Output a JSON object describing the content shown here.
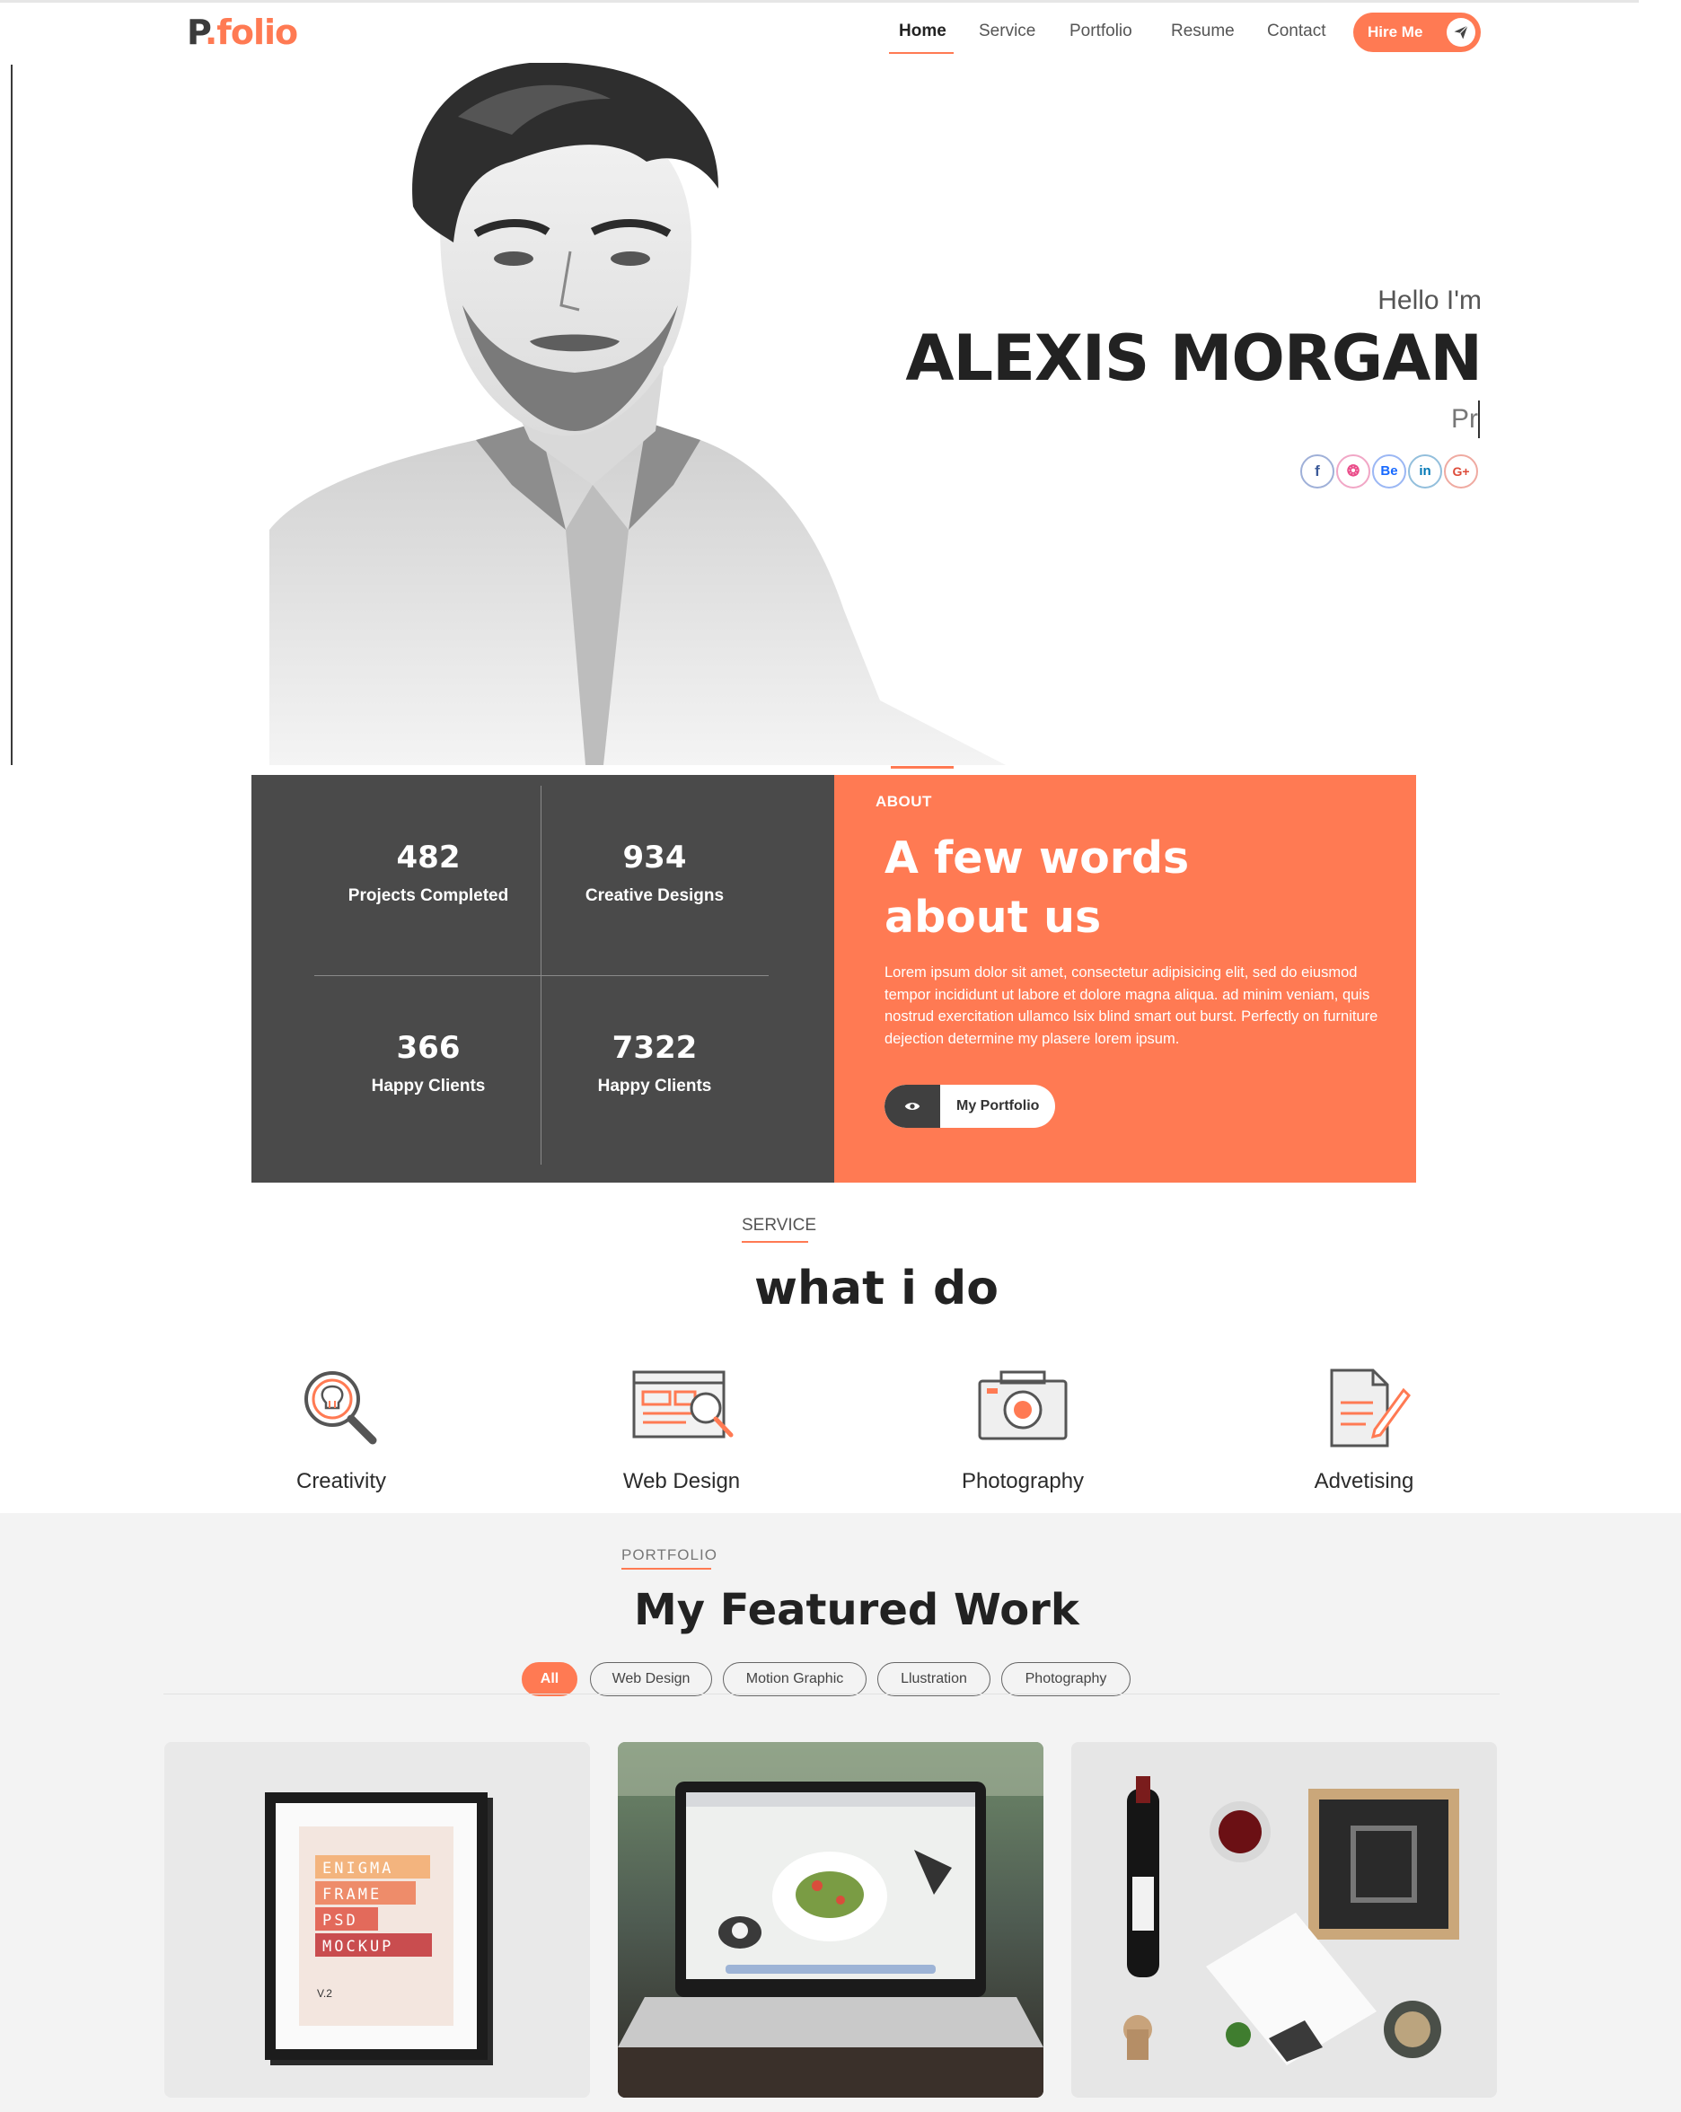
{
  "header": {
    "logo_main": "P",
    "logo_accent": ".folio",
    "nav": [
      "Home",
      "Service",
      "Portfolio",
      "Resume",
      "Contact"
    ],
    "hire_label": "Hire Me"
  },
  "hero": {
    "greeting": "Hello I'm",
    "name": "ALEXIS MORGAN",
    "typed_text": "Pr",
    "socials": [
      {
        "label": "f",
        "icon": "facebook-icon",
        "color": "#3b5998"
      },
      {
        "label": "❂",
        "icon": "dribbble-icon",
        "color": "#ea4c89"
      },
      {
        "label": "Be",
        "icon": "behance-icon",
        "color": "#1769ff"
      },
      {
        "label": "in",
        "icon": "linkedin-icon",
        "color": "#0077b5"
      },
      {
        "label": "G+",
        "icon": "google-plus-icon",
        "color": "#dd4b39"
      }
    ]
  },
  "stats": [
    {
      "value": "482",
      "label": "Projects Completed"
    },
    {
      "value": "934",
      "label": "Creative Designs"
    },
    {
      "value": "366",
      "label": "Happy Clients"
    },
    {
      "value": "7322",
      "label": "Happy Clients"
    }
  ],
  "about": {
    "tag": "ABOUT",
    "title": "A few words about us",
    "text": "Lorem ipsum dolor sit amet, consectetur adipisicing elit, sed do eiusmod tempor incididunt ut labore et dolore magna aliqua. ad minim veniam, quis nostrud exercitation ullamco lsix blind smart out burst. Perfectly on furniture dejection determine my plasere lorem ipsum.",
    "button": "My Portfolio"
  },
  "service": {
    "tag": "SERVICE",
    "title": "what i do",
    "items": [
      {
        "label": "Creativity",
        "icon": "idea-search-icon"
      },
      {
        "label": "Web Design",
        "icon": "web-design-icon"
      },
      {
        "label": "Photography",
        "icon": "camera-icon"
      },
      {
        "label": "Advetising",
        "icon": "document-pen-icon"
      }
    ]
  },
  "portfolio": {
    "tag": "PORTFOLIO",
    "title": "My Featured Work",
    "filters": [
      "All",
      "Web Design",
      "Motion Graphic",
      "Llustration",
      "Photography"
    ],
    "frame_lines": [
      "ENIGMA",
      "FRAME",
      "PSD",
      "MOCKUP"
    ],
    "frame_version": "V.2"
  },
  "colors": {
    "accent": "#ff7a53",
    "dark": "#4a4a4a"
  }
}
